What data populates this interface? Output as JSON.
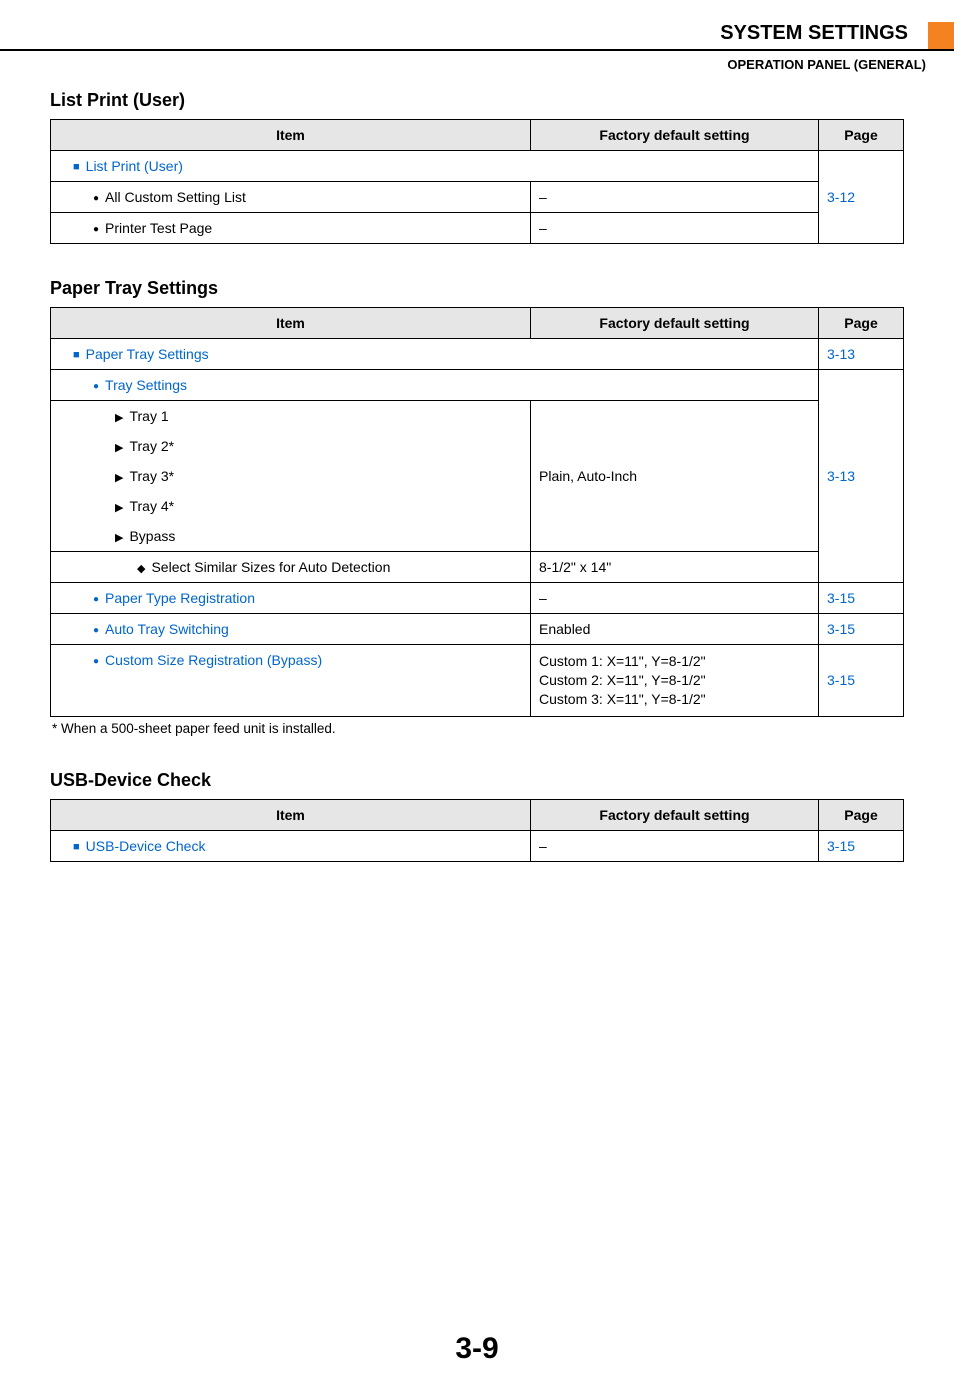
{
  "header": {
    "title": "SYSTEM SETTINGS",
    "sub": "OPERATION PANEL (GENERAL)"
  },
  "columns": {
    "item": "Item",
    "default": "Factory default setting",
    "page": "Page"
  },
  "section1": {
    "title": "List Print (User)",
    "rows": {
      "r1": {
        "label": "List Print (User)"
      },
      "r2": {
        "label": "All Custom Setting List",
        "default": "–"
      },
      "r3": {
        "label": "Printer Test Page",
        "default": "–"
      }
    },
    "page": "3-12"
  },
  "section2": {
    "title": "Paper Tray Settings",
    "rows": {
      "r1": {
        "label": "Paper Tray Settings",
        "page": "3-13"
      },
      "r2": {
        "label": "Tray Settings"
      },
      "r3": {
        "label": "Tray 1"
      },
      "r4": {
        "label": "Tray 2*"
      },
      "r5": {
        "label": "Tray 3*",
        "default": "Plain, Auto-Inch",
        "page": "3-13"
      },
      "r6": {
        "label": "Tray 4*"
      },
      "r7": {
        "label": "Bypass"
      },
      "r8": {
        "label": "Select Similar Sizes for Auto Detection",
        "default": "8-1/2\" x 14\""
      },
      "r9": {
        "label": "Paper Type Registration",
        "default": "–",
        "page": "3-15"
      },
      "r10": {
        "label": "Auto Tray Switching",
        "default": "Enabled",
        "page": "3-15"
      },
      "r11": {
        "label": "Custom Size Registration (Bypass)",
        "default_l1": "Custom 1: X=11\", Y=8-1/2\"",
        "default_l2": "Custom 2: X=11\", Y=8-1/2\"",
        "default_l3": "Custom 3: X=11\", Y=8-1/2\"",
        "page": "3-15"
      }
    },
    "footnote": "*  When a 500-sheet paper feed unit is installed."
  },
  "section3": {
    "title": "USB-Device Check",
    "rows": {
      "r1": {
        "label": "USB-Device Check",
        "default": "–",
        "page": "3-15"
      }
    }
  },
  "page_number": "3-9"
}
